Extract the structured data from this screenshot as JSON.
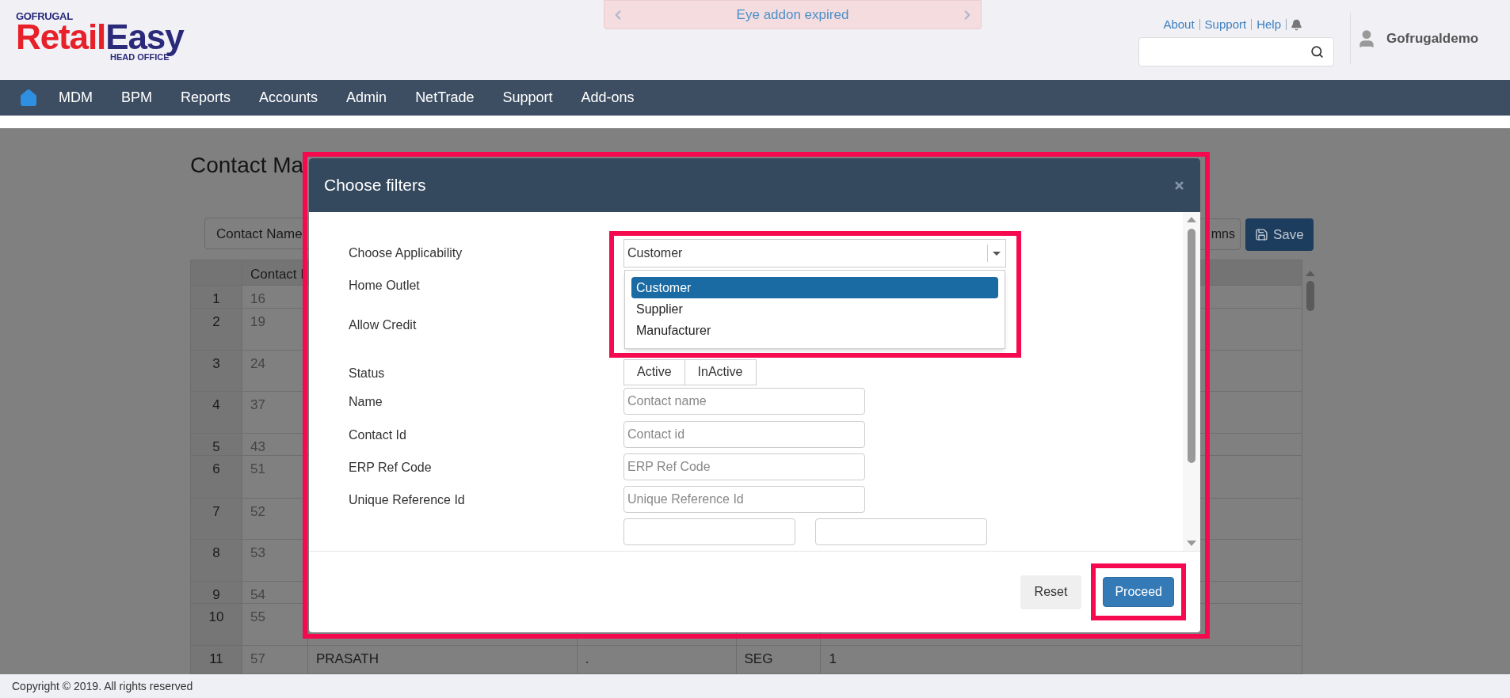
{
  "header": {
    "logo": {
      "brand": "GOFRUGAL",
      "product_first": "Retail",
      "product_second": "Easy",
      "edition": "HEAD OFFICE"
    },
    "banner": {
      "message": "Eye addon expired"
    },
    "top_links": [
      "About",
      "Support",
      "Help"
    ],
    "user": {
      "name": "Gofrugaldemo"
    }
  },
  "nav": {
    "items": [
      "MDM",
      "BPM",
      "Reports",
      "Accounts",
      "Admin",
      "NetTrade",
      "Support",
      "Add-ons"
    ]
  },
  "page": {
    "title": "Contact Ma",
    "toolbar": {
      "filter_button": "Contact Name",
      "columns_button": "mns",
      "save_button": "Save"
    },
    "table": {
      "columns": [
        "",
        "Contact I"
      ],
      "rows": [
        {
          "num": "1",
          "contact_id": "16"
        },
        {
          "num": "2",
          "contact_id": "19"
        },
        {
          "num": "3",
          "contact_id": "24"
        },
        {
          "num": "4",
          "contact_id": "37"
        },
        {
          "num": "5",
          "contact_id": "43"
        },
        {
          "num": "6",
          "contact_id": "51"
        },
        {
          "num": "7",
          "contact_id": "52"
        },
        {
          "num": "8",
          "contact_id": "53"
        },
        {
          "num": "9",
          "contact_id": "54"
        },
        {
          "num": "10",
          "contact_id": "55"
        },
        {
          "num": "11",
          "contact_id": "57",
          "name": "PRASATH",
          "column_4": ".",
          "column_5": "SEG",
          "column_6": "1"
        }
      ]
    }
  },
  "modal": {
    "title": "Choose filters",
    "fields": [
      {
        "kind": "select",
        "label": "Choose Applicability",
        "value": "Customer",
        "options": [
          {
            "label": "Customer",
            "selected": true
          },
          {
            "label": "Supplier",
            "selected": false
          },
          {
            "label": "Manufacturer",
            "selected": false
          }
        ]
      },
      {
        "kind": "covered",
        "label": "Home Outlet"
      },
      {
        "kind": "covered",
        "label": "Allow Credit"
      },
      {
        "kind": "toggle",
        "label": "Status",
        "options": [
          "Active",
          "InActive"
        ]
      },
      {
        "kind": "text",
        "label": "Name",
        "placeholder": "Contact name"
      },
      {
        "kind": "text",
        "label": "Contact Id",
        "placeholder": "Contact id"
      },
      {
        "kind": "text",
        "label": "ERP Ref Code",
        "placeholder": "ERP Ref Code"
      },
      {
        "kind": "text",
        "label": "Unique Reference Id",
        "placeholder": "Unique Reference Id"
      },
      {
        "kind": "range"
      }
    ],
    "buttons": {
      "reset": "Reset",
      "proceed": "Proceed"
    }
  },
  "footer": {
    "copyright": "Copyright © 2019. All rights reserved"
  }
}
